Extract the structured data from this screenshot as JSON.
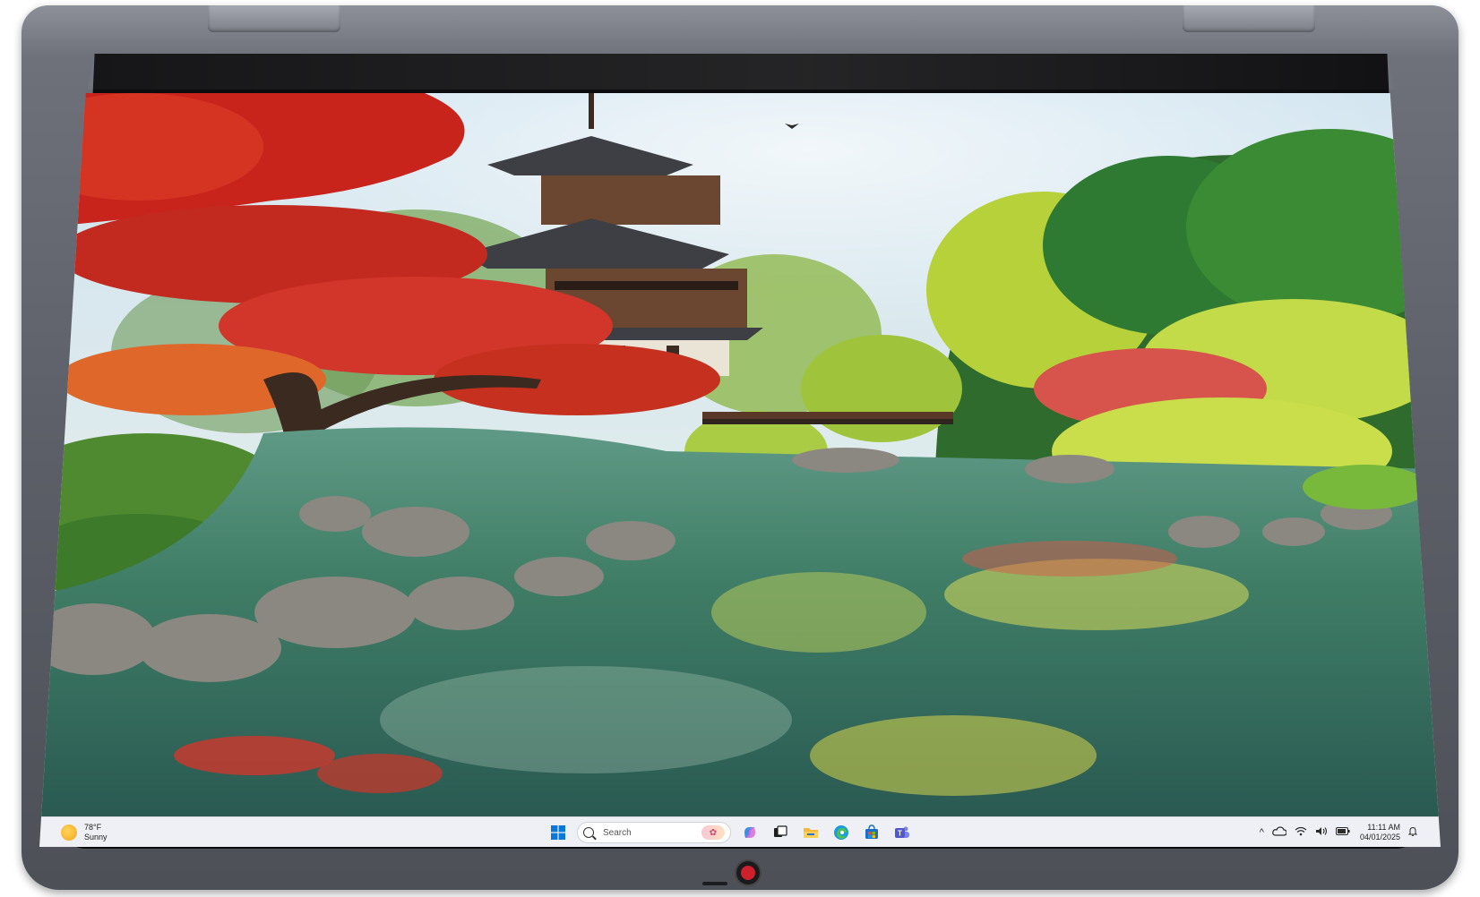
{
  "device": {
    "camera_color": "#d0202c",
    "chassis_color": "#5d5f68"
  },
  "wallpaper": {
    "icon": "pagoda-lake-wallpaper"
  },
  "taskbar": {
    "weather": {
      "temperature": "78°F",
      "condition": "Sunny",
      "icon": "sun-icon"
    },
    "start_icon": "windows-start-icon",
    "search": {
      "placeholder": "Search",
      "icon": "search-icon"
    },
    "pinned_apps": [
      {
        "name": "copilot-icon"
      },
      {
        "name": "task-view-icon"
      },
      {
        "name": "file-explorer-icon"
      },
      {
        "name": "edge-icon"
      },
      {
        "name": "store-icon"
      },
      {
        "name": "teams-icon"
      }
    ],
    "tray": {
      "chevron": "^",
      "icons": [
        "onedrive-icon",
        "wifi-icon",
        "volume-icon",
        "battery-icon"
      ],
      "time": "11:11 AM",
      "date": "04/01/2025",
      "notification_icon": "bell-icon"
    },
    "accent": "#0067c0"
  }
}
